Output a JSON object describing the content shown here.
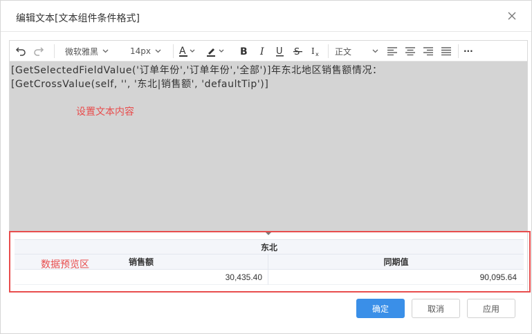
{
  "dialog": {
    "title": "编辑文本[文本组件条件格式]"
  },
  "toolbar": {
    "font_family": "微软雅黑",
    "font_size": "14px",
    "paragraph_style": "正文",
    "more_label": "···"
  },
  "editor": {
    "line1": "[GetSelectedFieldValue('订单年份','订单年份','全部')]年东北地区销售额情况：",
    "line2": "[GetCrossValue(self, '', '东北|销售额', 'defaultTip')]",
    "annotation_content": "设置文本内容"
  },
  "preview": {
    "annotation": "数据预览区",
    "group_header": "东北",
    "columns": [
      "销售额",
      "同期值"
    ],
    "rows": [
      [
        "30,435.40",
        "90,095.64"
      ]
    ]
  },
  "footer": {
    "ok_label": "确定",
    "cancel_label": "取消",
    "apply_label": "应用"
  },
  "colors": {
    "primary": "#3a8fe8",
    "annotation_red": "#e84c4c",
    "content_bg": "#d4d4d4"
  }
}
